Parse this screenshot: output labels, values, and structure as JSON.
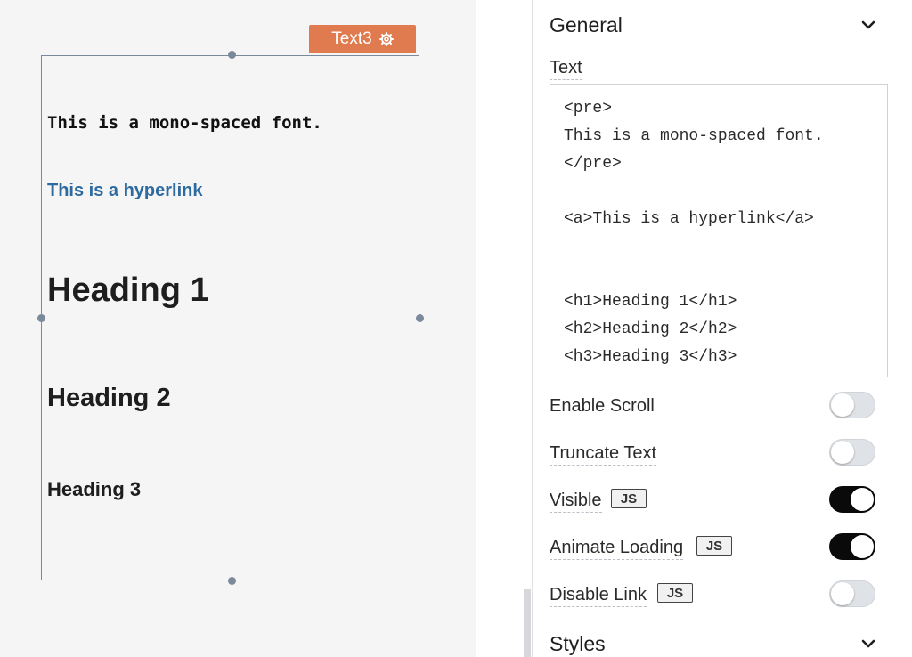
{
  "widget": {
    "tag_label": "Text3",
    "mono_text": "This is a mono-spaced font.",
    "link_text": "This is a hyperlink",
    "heading1": "Heading 1",
    "heading2": "Heading 2",
    "heading3": "Heading 3"
  },
  "inspector": {
    "general_title": "General",
    "text_label": "Text",
    "text_value": "<pre>\nThis is a mono-spaced font.\n</pre>\n\n<a>This is a hyperlink</a>\n\n\n<h1>Heading 1</h1>\n<h2>Heading 2</h2>\n<h3>Heading 3</h3>",
    "props": [
      {
        "label": "Enable Scroll",
        "js": false,
        "on": false
      },
      {
        "label": "Truncate Text",
        "js": false,
        "on": false
      },
      {
        "label": "Visible",
        "js": true,
        "on": true
      },
      {
        "label": "Animate Loading",
        "js": true,
        "on": true
      },
      {
        "label": "Disable Link",
        "js": true,
        "on": false
      }
    ],
    "js_badge_label": "JS",
    "styles_title": "Styles"
  },
  "colors": {
    "accent_tag": "#e07b4f",
    "link": "#2c6aa0",
    "toggle_on": "#0a0a0a",
    "toggle_off": "#dfe2e6"
  },
  "icons": {
    "tag_settings": "gear-icon",
    "section_toggle": "chevron-down-icon"
  }
}
